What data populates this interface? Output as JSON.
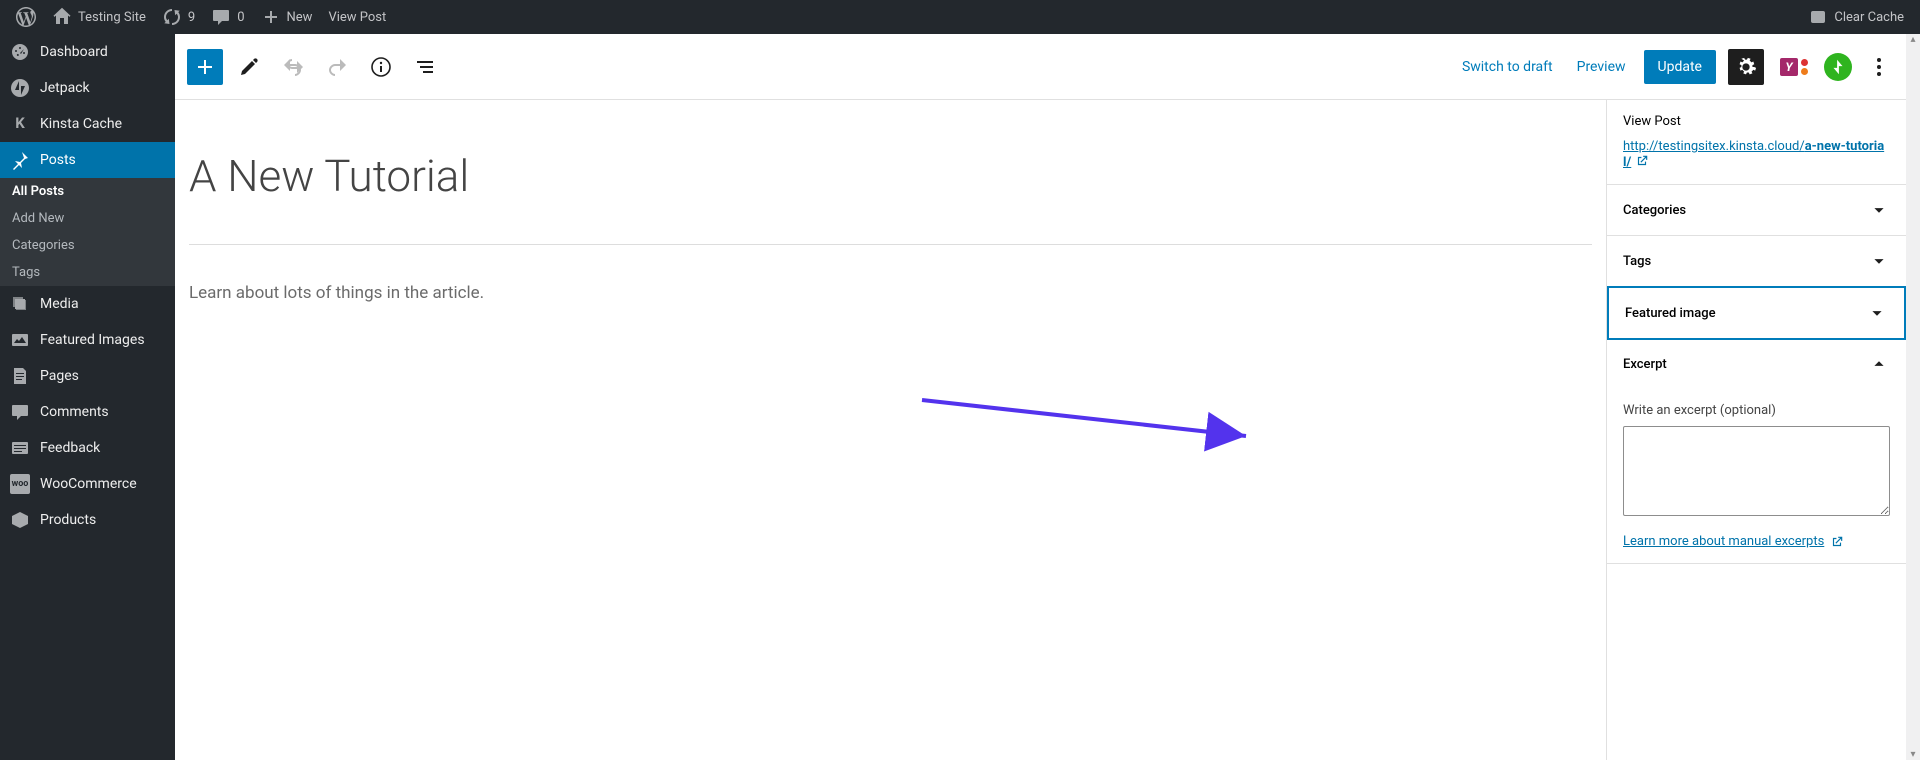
{
  "adminbar": {
    "site_name": "Testing Site",
    "update_count": "9",
    "comment_count": "0",
    "new_label": "New",
    "view_post_label": "View Post",
    "clear_cache_label": "Clear Cache"
  },
  "sidebar": {
    "items": [
      {
        "label": "Dashboard"
      },
      {
        "label": "Jetpack"
      },
      {
        "label": "Kinsta Cache"
      },
      {
        "label": "Posts"
      },
      {
        "label": "Media"
      },
      {
        "label": "Featured Images"
      },
      {
        "label": "Pages"
      },
      {
        "label": "Comments"
      },
      {
        "label": "Feedback"
      },
      {
        "label": "WooCommerce"
      },
      {
        "label": "Products"
      }
    ],
    "posts_sub": [
      {
        "label": "All Posts"
      },
      {
        "label": "Add New"
      },
      {
        "label": "Categories"
      },
      {
        "label": "Tags"
      }
    ]
  },
  "topbar": {
    "switch_label": "Switch to draft",
    "preview_label": "Preview",
    "update_label": "Update"
  },
  "post": {
    "title": "A New Tutorial",
    "content": "Learn about lots of things in the article."
  },
  "panel": {
    "view_post_label": "View Post",
    "permalink_prefix": "http://testingsitex.kinsta.cloud/",
    "permalink_slug": "a-new-tutorial/",
    "categories_label": "Categories",
    "tags_label": "Tags",
    "featured_label": "Featured image",
    "excerpt_label": "Excerpt",
    "excerpt_field_label": "Write an excerpt (optional)",
    "learn_more_label": "Learn more about manual excerpts"
  }
}
